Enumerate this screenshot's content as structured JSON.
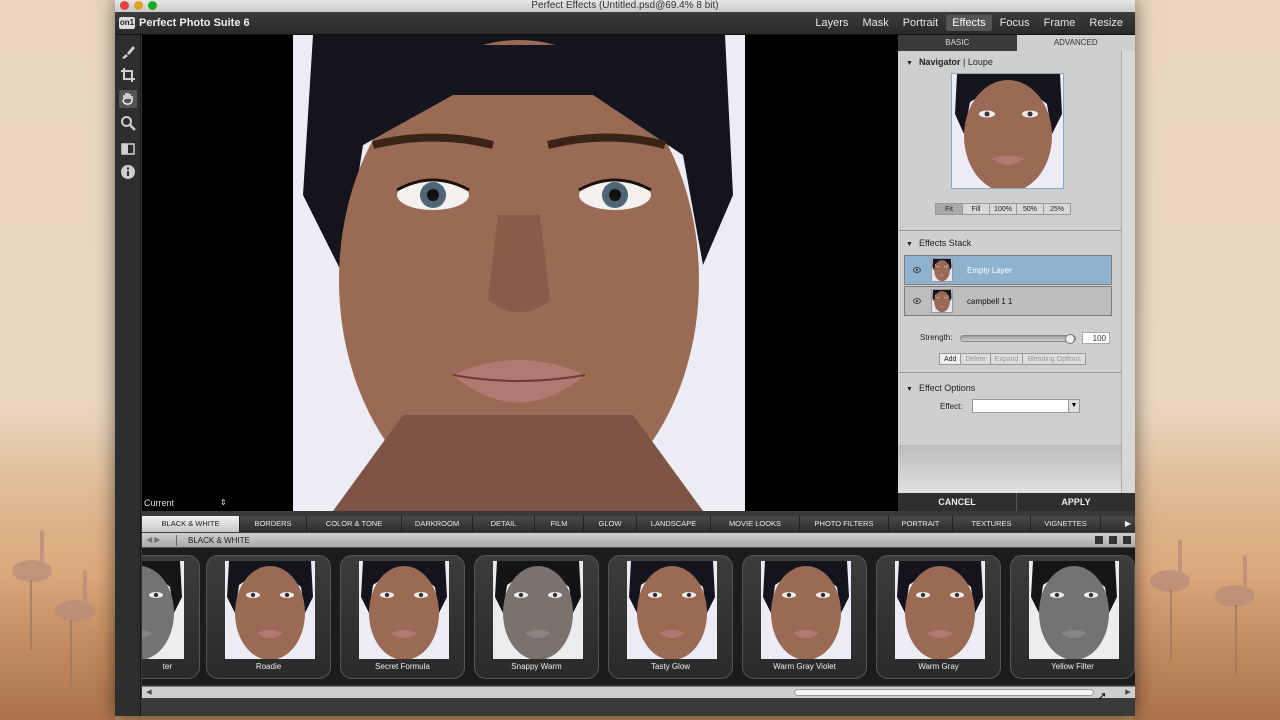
{
  "window": {
    "title": "Perfect Effects (Untitled.psd@69.4% 8 bit)"
  },
  "app": {
    "logo": "on1",
    "name": "Perfect Photo Suite 6"
  },
  "modules": [
    "Layers",
    "Mask",
    "Portrait",
    "Effects",
    "Focus",
    "Frame",
    "Resize"
  ],
  "active_module": "Effects",
  "tools": [
    "brush-icon",
    "crop-icon",
    "hand-icon",
    "zoom-icon",
    "compare-icon",
    "info-icon"
  ],
  "canvas": {
    "preview_mode": "Current"
  },
  "panel": {
    "tabs": {
      "basic": "BASIC",
      "advanced": "ADVANCED"
    },
    "navigator": {
      "title": "Navigator",
      "separator": "|",
      "loupe": "Loupe",
      "zoom_buttons": [
        "Fit",
        "Fill",
        "100%",
        "50%",
        "25%"
      ],
      "active_zoom": "Fit"
    },
    "effects_stack": {
      "title": "Effects Stack",
      "layers": [
        "Empty Layer",
        "campbell 1 1"
      ],
      "selected_layer": "Empty Layer",
      "strength_label": "Strength:",
      "strength_value": "100",
      "buttons": [
        "Add",
        "Delete",
        "Expand",
        "Blending Options"
      ]
    },
    "effect_options": {
      "title": "Effect Options",
      "effect_label": "Effect:",
      "effect_value": ""
    }
  },
  "actions": {
    "cancel": "CANCEL",
    "apply": "APPLY"
  },
  "categories": [
    "BLACK & WHITE",
    "BORDERS",
    "COLOR & TONE",
    "DARKROOM",
    "DETAIL",
    "FILM",
    "GLOW",
    "LANDSCAPE",
    "MOVIE LOOKS",
    "PHOTO FILTERS",
    "PORTRAIT",
    "TEXTURES",
    "VIGNETTES"
  ],
  "active_category": "BLACK & WHITE",
  "subbar": {
    "label": "BLACK & WHITE"
  },
  "presets": [
    "ter",
    "Roadie",
    "Secret Formula",
    "Snappy Warm",
    "Tasty Glow",
    "Warm Gray Violet",
    "Warm Gray",
    "Yellow Filter"
  ],
  "colors": {
    "accent_selected": "#8fb3cf",
    "window_bg": "#3a3a3a",
    "panel_bg": "#cfcfcf"
  }
}
